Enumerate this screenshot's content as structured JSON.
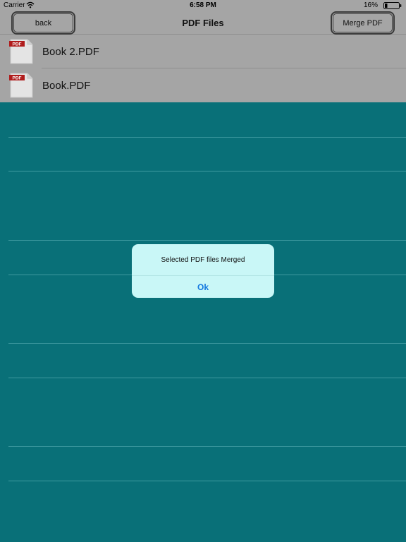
{
  "status_bar": {
    "carrier": "Carrier",
    "time": "6:58 PM",
    "battery_percent": "16%",
    "wifi_icon": "wifi-icon",
    "battery_icon": "battery-icon"
  },
  "nav_bar": {
    "back_label": "back",
    "title": "PDF Files",
    "merge_label": "Merge PDF"
  },
  "files": [
    {
      "name": "Book 2.PDF",
      "icon": "pdf-file-icon",
      "icon_label": "PDF"
    },
    {
      "name": "Book.PDF",
      "icon": "pdf-file-icon",
      "icon_label": "PDF"
    }
  ],
  "alert": {
    "message": "Selected PDF files Merged",
    "ok_label": "Ok"
  },
  "colors": {
    "background": "#097078",
    "bar": "#a5a5a5",
    "alert_bg": "#c9f7f7",
    "accent": "#1579e0",
    "pdf_red": "#b01c1c"
  }
}
